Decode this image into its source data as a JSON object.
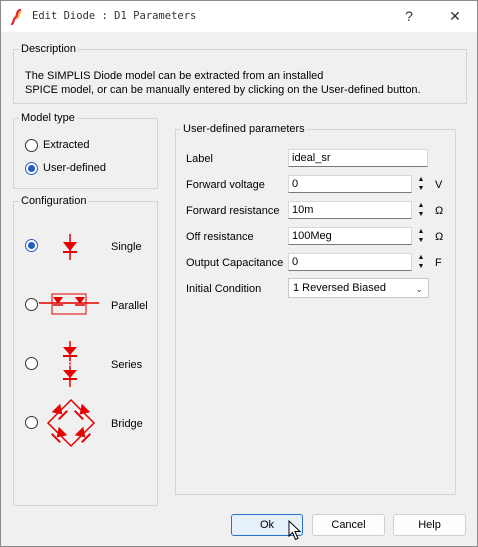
{
  "window": {
    "title": "Edit Diode : D1 Parameters",
    "help_glyph": "?",
    "close_glyph": "✕"
  },
  "description": {
    "heading": "Description",
    "line1": "The SIMPLIS Diode model can be extracted from an installed",
    "line2": "SPICE model, or can be manually entered by clicking on the User-defined button."
  },
  "model_type": {
    "heading": "Model type",
    "options": [
      {
        "label": "Extracted",
        "checked": false
      },
      {
        "label": "User-defined",
        "checked": true
      }
    ]
  },
  "configuration": {
    "heading": "Configuration",
    "options": [
      {
        "label": "Single",
        "checked": true,
        "icon": "single-diode-icon"
      },
      {
        "label": "Parallel",
        "checked": false,
        "icon": "parallel-diodes-icon"
      },
      {
        "label": "Series",
        "checked": false,
        "icon": "series-diodes-icon"
      },
      {
        "label": "Bridge",
        "checked": false,
        "icon": "bridge-diodes-icon"
      }
    ]
  },
  "params": {
    "heading": "User-defined parameters",
    "label": {
      "label": "Label",
      "value": "ideal_sr"
    },
    "forward_voltage": {
      "label": "Forward voltage",
      "value": "0",
      "unit": "V"
    },
    "forward_resistance": {
      "label": "Forward resistance",
      "value": "10m",
      "unit": "Ω"
    },
    "off_resistance": {
      "label": "Off resistance",
      "value": "100Meg",
      "unit": "Ω"
    },
    "output_capacitance": {
      "label": "Output Capacitance",
      "value": "0",
      "unit": "F"
    },
    "initial_condition": {
      "label": "Initial Condition",
      "value": "1 Reversed Biased"
    }
  },
  "buttons": {
    "ok": "Ok",
    "cancel": "Cancel",
    "help": "Help"
  },
  "colors": {
    "accent": "#1f5fbf",
    "diode": "#e60000"
  }
}
